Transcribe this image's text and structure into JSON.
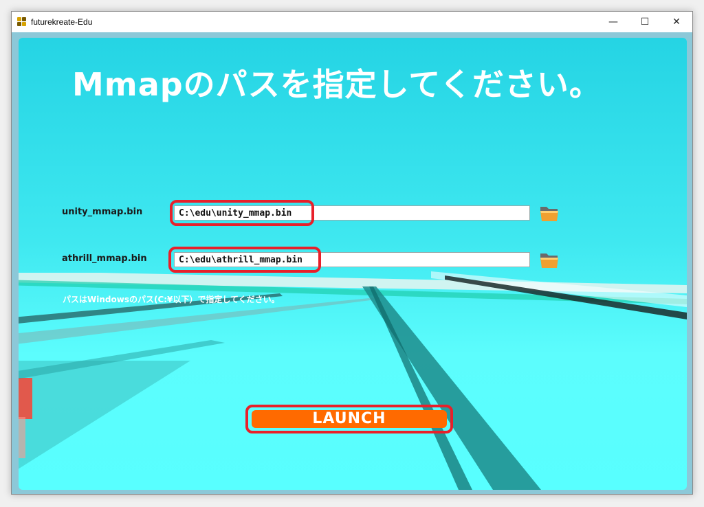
{
  "window": {
    "title": "futurekreate-Edu",
    "minimize_glyph": "—",
    "maximize_glyph": "☐",
    "close_glyph": "✕"
  },
  "main": {
    "heading": "Mmapのパスを指定してください。",
    "fields": [
      {
        "label": "unity_mmap.bin",
        "value": "C:\\edu\\unity_mmap.bin",
        "browse_icon": "folder-icon"
      },
      {
        "label": "athrill_mmap.bin",
        "value": "C:\\edu\\athrill_mmap.bin",
        "browse_icon": "folder-icon"
      }
    ],
    "hint": "パスはWindowsのパス(C:¥以下）で指定してください。",
    "launch_label": "LAUNCH"
  },
  "colors": {
    "background_cyan": "#3fe8f0",
    "highlight_red": "#e8202a",
    "launch_orange": "#ff6a00",
    "heading_white": "#ffffff"
  }
}
